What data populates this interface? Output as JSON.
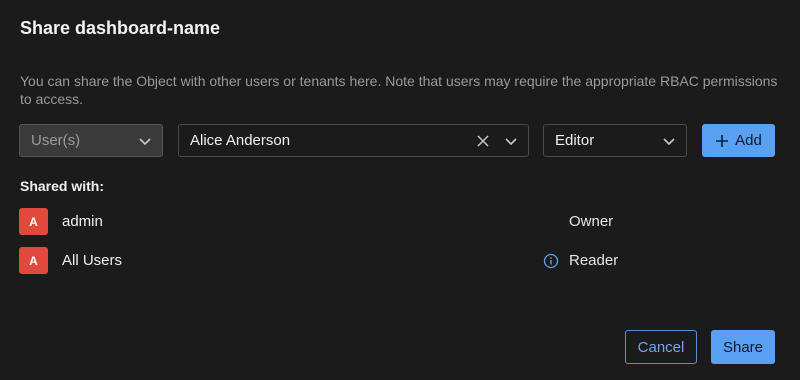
{
  "dialog": {
    "title": "Share dashboard-name",
    "description": "You can share the Object with other users or tenants here. Note that users may require the appropriate RBAC permissions to access."
  },
  "form": {
    "type_select": {
      "value": "User(s)",
      "icon": "chevron-down-icon"
    },
    "user_select": {
      "value": "Alice Anderson",
      "clear_icon": "close-icon",
      "icon": "chevron-down-icon"
    },
    "role_select": {
      "value": "Editor",
      "icon": "chevron-down-icon"
    },
    "add_button": {
      "icon": "plus-icon",
      "label": "Add"
    }
  },
  "shared": {
    "label": "Shared with:",
    "rows": [
      {
        "avatar": "A",
        "name": "admin",
        "role": "Owner",
        "info_icon": false
      },
      {
        "avatar": "A",
        "name": "All Users",
        "role": "Reader",
        "info_icon": true
      }
    ]
  },
  "footer": {
    "cancel_label": "Cancel",
    "share_label": "Share"
  },
  "colors": {
    "background": "#1b1b1b",
    "primary": "#5aa0f2",
    "avatar": "#e04a3c",
    "muted_text": "#9a9a9a"
  }
}
